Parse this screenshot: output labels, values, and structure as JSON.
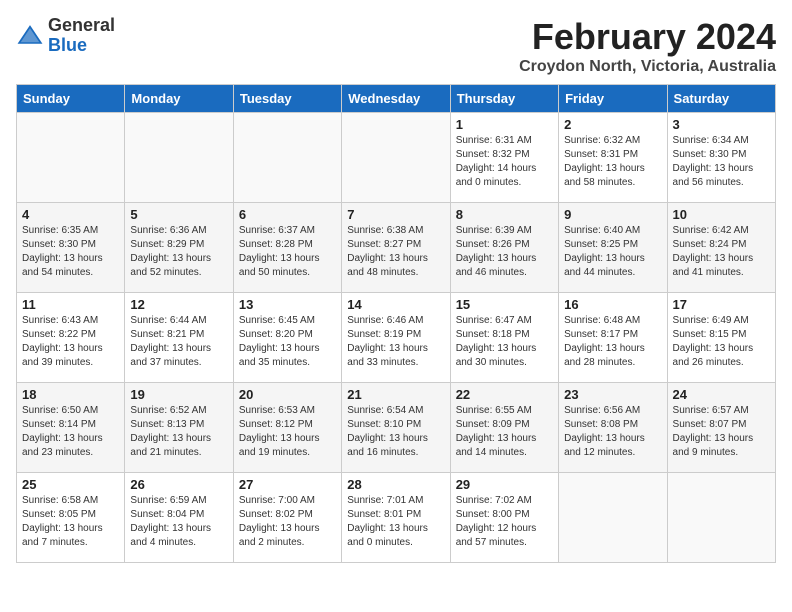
{
  "header": {
    "logo_general": "General",
    "logo_blue": "Blue",
    "month_title": "February 2024",
    "location": "Croydon North, Victoria, Australia"
  },
  "days_of_week": [
    "Sunday",
    "Monday",
    "Tuesday",
    "Wednesday",
    "Thursday",
    "Friday",
    "Saturday"
  ],
  "weeks": [
    [
      {
        "day": "",
        "info": ""
      },
      {
        "day": "",
        "info": ""
      },
      {
        "day": "",
        "info": ""
      },
      {
        "day": "",
        "info": ""
      },
      {
        "day": "1",
        "info": "Sunrise: 6:31 AM\nSunset: 8:32 PM\nDaylight: 14 hours\nand 0 minutes."
      },
      {
        "day": "2",
        "info": "Sunrise: 6:32 AM\nSunset: 8:31 PM\nDaylight: 13 hours\nand 58 minutes."
      },
      {
        "day": "3",
        "info": "Sunrise: 6:34 AM\nSunset: 8:30 PM\nDaylight: 13 hours\nand 56 minutes."
      }
    ],
    [
      {
        "day": "4",
        "info": "Sunrise: 6:35 AM\nSunset: 8:30 PM\nDaylight: 13 hours\nand 54 minutes."
      },
      {
        "day": "5",
        "info": "Sunrise: 6:36 AM\nSunset: 8:29 PM\nDaylight: 13 hours\nand 52 minutes."
      },
      {
        "day": "6",
        "info": "Sunrise: 6:37 AM\nSunset: 8:28 PM\nDaylight: 13 hours\nand 50 minutes."
      },
      {
        "day": "7",
        "info": "Sunrise: 6:38 AM\nSunset: 8:27 PM\nDaylight: 13 hours\nand 48 minutes."
      },
      {
        "day": "8",
        "info": "Sunrise: 6:39 AM\nSunset: 8:26 PM\nDaylight: 13 hours\nand 46 minutes."
      },
      {
        "day": "9",
        "info": "Sunrise: 6:40 AM\nSunset: 8:25 PM\nDaylight: 13 hours\nand 44 minutes."
      },
      {
        "day": "10",
        "info": "Sunrise: 6:42 AM\nSunset: 8:24 PM\nDaylight: 13 hours\nand 41 minutes."
      }
    ],
    [
      {
        "day": "11",
        "info": "Sunrise: 6:43 AM\nSunset: 8:22 PM\nDaylight: 13 hours\nand 39 minutes."
      },
      {
        "day": "12",
        "info": "Sunrise: 6:44 AM\nSunset: 8:21 PM\nDaylight: 13 hours\nand 37 minutes."
      },
      {
        "day": "13",
        "info": "Sunrise: 6:45 AM\nSunset: 8:20 PM\nDaylight: 13 hours\nand 35 minutes."
      },
      {
        "day": "14",
        "info": "Sunrise: 6:46 AM\nSunset: 8:19 PM\nDaylight: 13 hours\nand 33 minutes."
      },
      {
        "day": "15",
        "info": "Sunrise: 6:47 AM\nSunset: 8:18 PM\nDaylight: 13 hours\nand 30 minutes."
      },
      {
        "day": "16",
        "info": "Sunrise: 6:48 AM\nSunset: 8:17 PM\nDaylight: 13 hours\nand 28 minutes."
      },
      {
        "day": "17",
        "info": "Sunrise: 6:49 AM\nSunset: 8:15 PM\nDaylight: 13 hours\nand 26 minutes."
      }
    ],
    [
      {
        "day": "18",
        "info": "Sunrise: 6:50 AM\nSunset: 8:14 PM\nDaylight: 13 hours\nand 23 minutes."
      },
      {
        "day": "19",
        "info": "Sunrise: 6:52 AM\nSunset: 8:13 PM\nDaylight: 13 hours\nand 21 minutes."
      },
      {
        "day": "20",
        "info": "Sunrise: 6:53 AM\nSunset: 8:12 PM\nDaylight: 13 hours\nand 19 minutes."
      },
      {
        "day": "21",
        "info": "Sunrise: 6:54 AM\nSunset: 8:10 PM\nDaylight: 13 hours\nand 16 minutes."
      },
      {
        "day": "22",
        "info": "Sunrise: 6:55 AM\nSunset: 8:09 PM\nDaylight: 13 hours\nand 14 minutes."
      },
      {
        "day": "23",
        "info": "Sunrise: 6:56 AM\nSunset: 8:08 PM\nDaylight: 13 hours\nand 12 minutes."
      },
      {
        "day": "24",
        "info": "Sunrise: 6:57 AM\nSunset: 8:07 PM\nDaylight: 13 hours\nand 9 minutes."
      }
    ],
    [
      {
        "day": "25",
        "info": "Sunrise: 6:58 AM\nSunset: 8:05 PM\nDaylight: 13 hours\nand 7 minutes."
      },
      {
        "day": "26",
        "info": "Sunrise: 6:59 AM\nSunset: 8:04 PM\nDaylight: 13 hours\nand 4 minutes."
      },
      {
        "day": "27",
        "info": "Sunrise: 7:00 AM\nSunset: 8:02 PM\nDaylight: 13 hours\nand 2 minutes."
      },
      {
        "day": "28",
        "info": "Sunrise: 7:01 AM\nSunset: 8:01 PM\nDaylight: 13 hours\nand 0 minutes."
      },
      {
        "day": "29",
        "info": "Sunrise: 7:02 AM\nSunset: 8:00 PM\nDaylight: 12 hours\nand 57 minutes."
      },
      {
        "day": "",
        "info": ""
      },
      {
        "day": "",
        "info": ""
      }
    ]
  ]
}
